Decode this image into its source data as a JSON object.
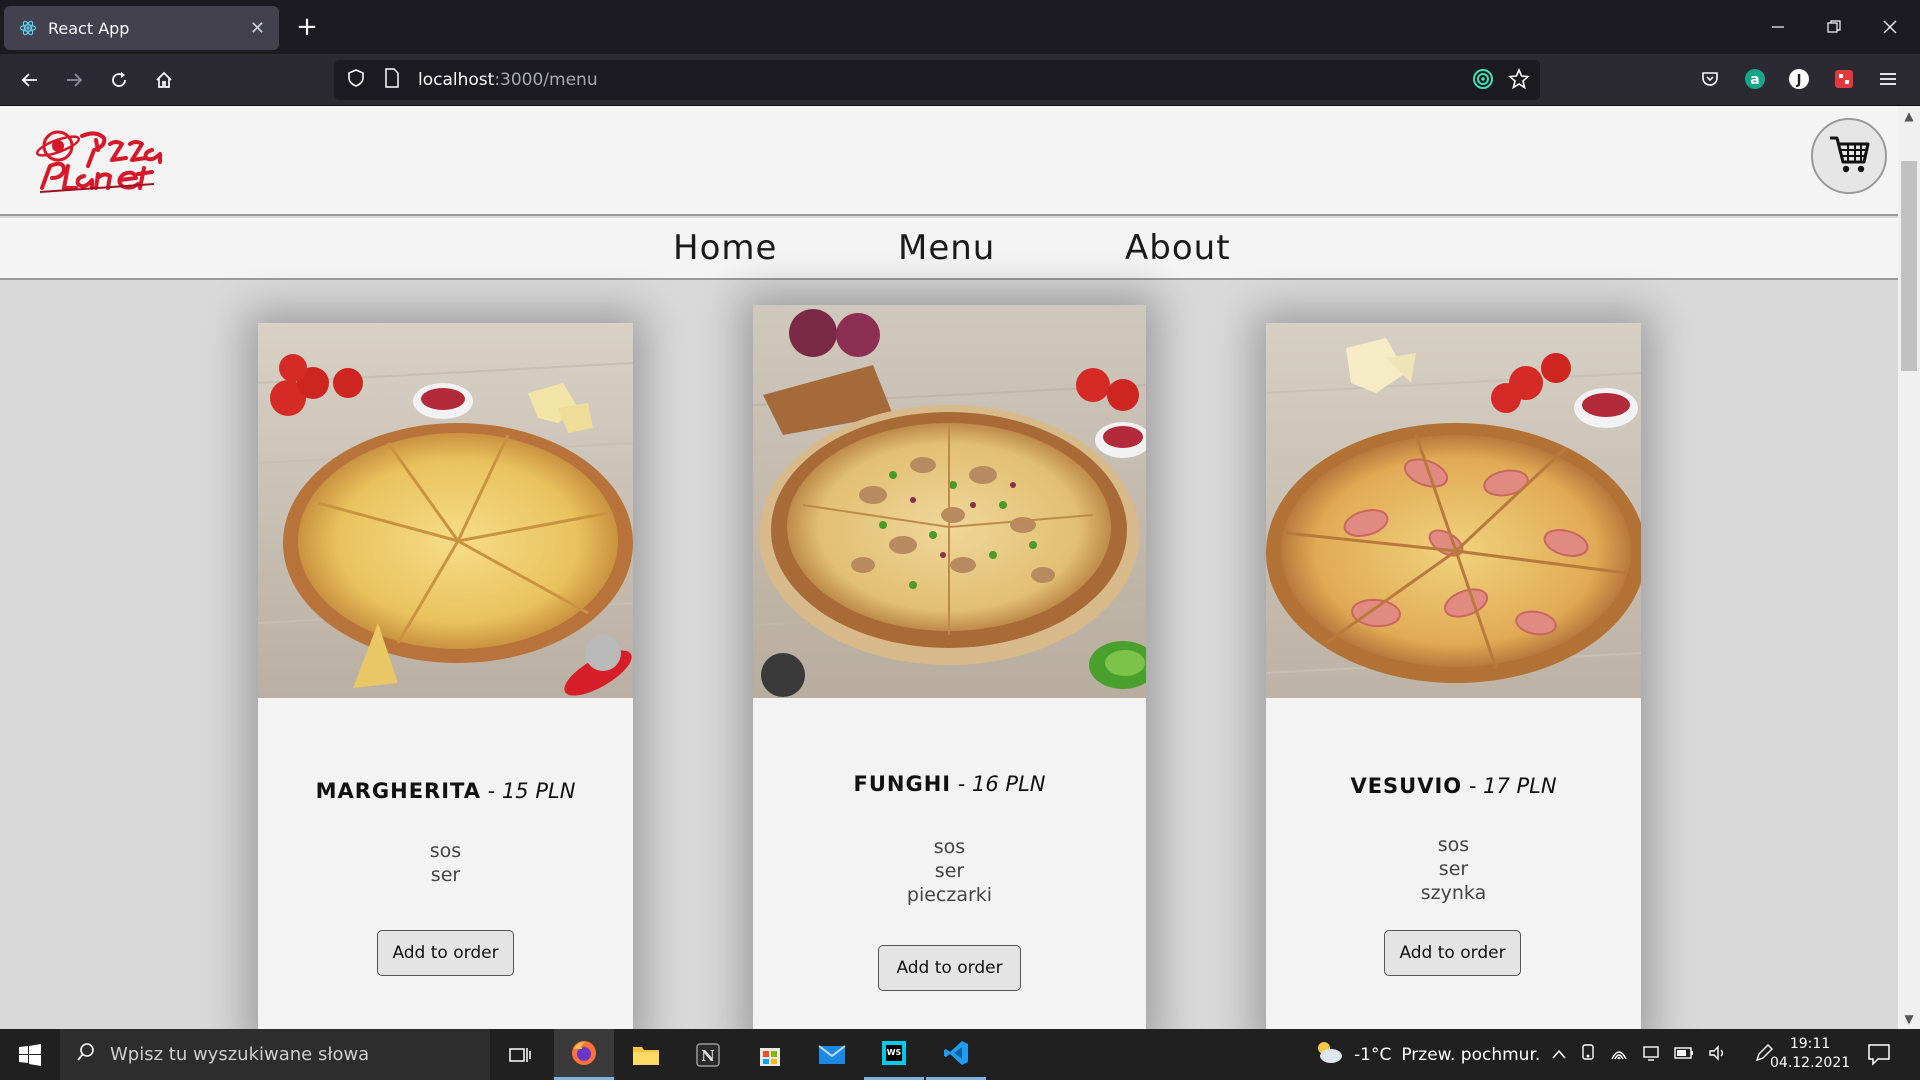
{
  "browser": {
    "tab_title": "React App",
    "tab_close": "✕",
    "new_tab": "+",
    "url_host": "localhost",
    "url_path": ":3000/menu"
  },
  "site": {
    "logo_alt": "Pizza Planet",
    "nav": [
      "Home",
      "Menu",
      "About"
    ]
  },
  "menu_items": [
    {
      "name": "MARGHERITA",
      "separator": " - ",
      "price": "15 PLN",
      "ingredients": [
        "sos",
        "ser"
      ],
      "button": "Add to order"
    },
    {
      "name": "FUNGHI",
      "separator": " - ",
      "price": "16 PLN",
      "ingredients": [
        "sos",
        "ser",
        "pieczarki"
      ],
      "button": "Add to order"
    },
    {
      "name": "VESUVIO",
      "separator": " - ",
      "price": "17 PLN",
      "ingredients": [
        "sos",
        "ser",
        "szynka"
      ],
      "button": "Add to order"
    }
  ],
  "taskbar": {
    "search_placeholder": "Wpisz tu wyszukiwane słowa",
    "weather_temp": "-1°C",
    "weather_desc": "Przew. pochmur.",
    "time": "19:11",
    "date": "04.12.2021"
  },
  "colors": {
    "accent_red": "#d6192a",
    "chrome_dark": "#1c1b22",
    "toolbar": "#2b2a33",
    "page_bg": "#d9d9d9"
  }
}
